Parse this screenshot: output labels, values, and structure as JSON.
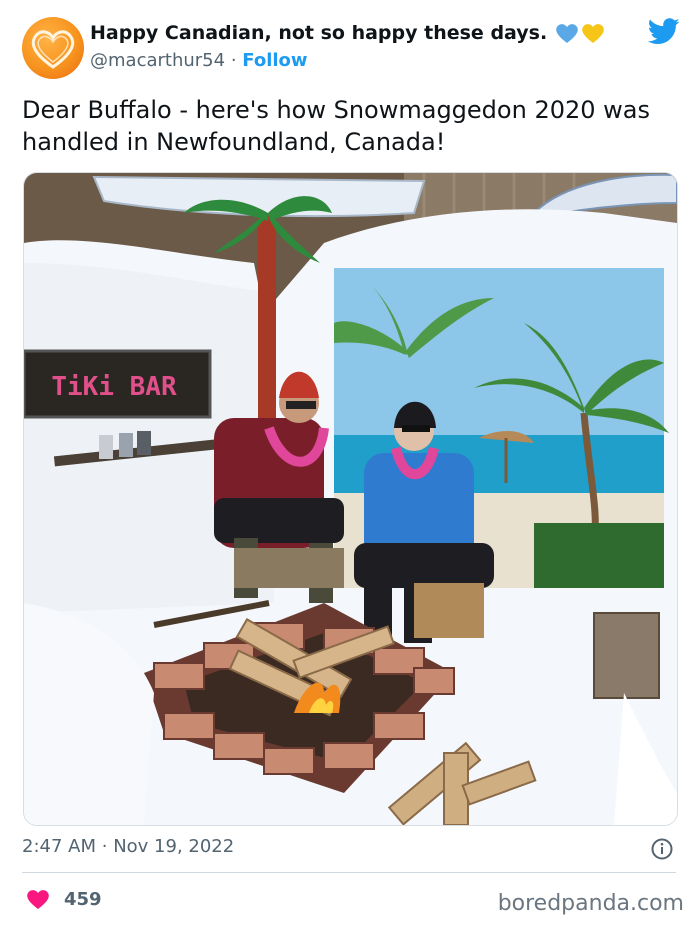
{
  "tweet": {
    "display_name": "Happy Canadian, not so happy these days.",
    "handle": "@macarthur54",
    "separator": "·",
    "follow_label": "Follow",
    "text": "Dear Buffalo - here's how Snowmaggedon 2020 was handled in Newfoundland, Canada!",
    "time": "2:47 AM",
    "date": "Nov 19, 2022",
    "like_count": "459"
  },
  "photo": {
    "sign_text": "TiKi BAR"
  },
  "watermark": "boredpanda.com",
  "colors": {
    "accent": "#1d9bf0",
    "like": "#f91880",
    "muted": "#536471",
    "heart_blue": "#5aa9e6",
    "heart_yellow": "#f5c518"
  },
  "icons": [
    "heart-avatar-icon",
    "blue-heart-icon",
    "yellow-heart-icon",
    "twitter-bird-icon",
    "info-icon",
    "like-heart-icon"
  ]
}
